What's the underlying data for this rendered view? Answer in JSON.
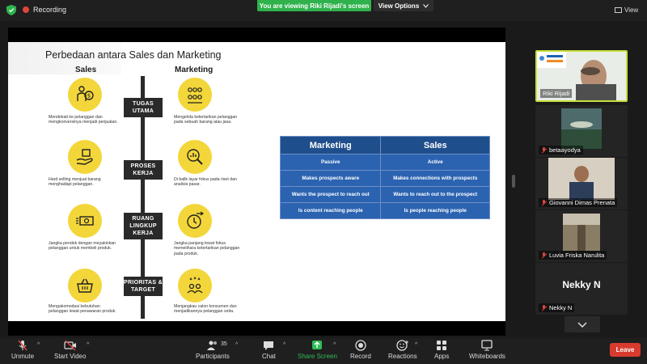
{
  "topbar": {
    "recording_label": "Recording",
    "viewing_banner": "You are viewing Riki Rijadi's screen",
    "view_options_label": "View Options",
    "view_label": "View"
  },
  "slide": {
    "title": "Perbedaan antara Sales dan Marketing",
    "sales_header": "Sales",
    "marketing_header": "Marketing",
    "tags": [
      "TUGAS UTAMA",
      "PROSES KERJA",
      "RUANG LINGKUP KERJA",
      "PRIORITAS & TARGET"
    ],
    "sales_desc": [
      "Mendekati ke pelanggan dan mengkonversinya menjadi penjualan.",
      "Hard selling menjual barang menghadapi pelanggan.",
      "Jangka pendek dengan meyakinkan pelanggan untuk membeli produk.",
      "Mengakomodasi kebutuhan pelanggan lewat penawaran produk."
    ],
    "marketing_desc": [
      "Mengelola ketertarikan pelanggan pada sebuah barang atau jasa.",
      "Di balik layar fokus pada riset dan analisis pasar.",
      "Jangka panjang lewat fokus memelihara ketertarikan pelanggan pada produk.",
      "Menjangkau calon konsumen dan menjadikannya pelanggan setia."
    ]
  },
  "table": {
    "headers": [
      "Marketing",
      "Sales"
    ],
    "rows": [
      [
        "Passive",
        "Active"
      ],
      [
        "Makes prospects aware",
        "Makes connections with prospects"
      ],
      [
        "Wants the prospect to reach out",
        "Wants to reach out to the prospect"
      ],
      [
        "Is content reaching people",
        "Is people reaching people"
      ]
    ]
  },
  "gallery": {
    "participants": [
      {
        "name": "Riki Rijadi",
        "active": true,
        "muted": false
      },
      {
        "name": "betaayodya",
        "active": false,
        "muted": true
      },
      {
        "name": "Giovanni Dimas Prenata",
        "active": false,
        "muted": true
      },
      {
        "name": "Luvia Friska Narulita",
        "active": false,
        "muted": true
      },
      {
        "name": "Nekky N",
        "active": false,
        "muted": true,
        "avatar_text": "Nekky N"
      }
    ]
  },
  "toolbar": {
    "unmute": "Unmute",
    "start_video": "Start Video",
    "participants": "Participants",
    "participants_count": "35",
    "chat": "Chat",
    "share_screen": "Share Screen",
    "record": "Record",
    "reactions": "Reactions",
    "apps": "Apps",
    "whiteboards": "Whiteboards",
    "leave": "Leave"
  },
  "colors": {
    "recording_red": "#e0453b",
    "banner_green": "#2fb24c",
    "table_header": "#1f4e8c",
    "table_cell": "#2b63b1",
    "icon_yellow": "#f3d63a",
    "active_speaker": "#c7df3e",
    "leave_red": "#d93a2e"
  }
}
